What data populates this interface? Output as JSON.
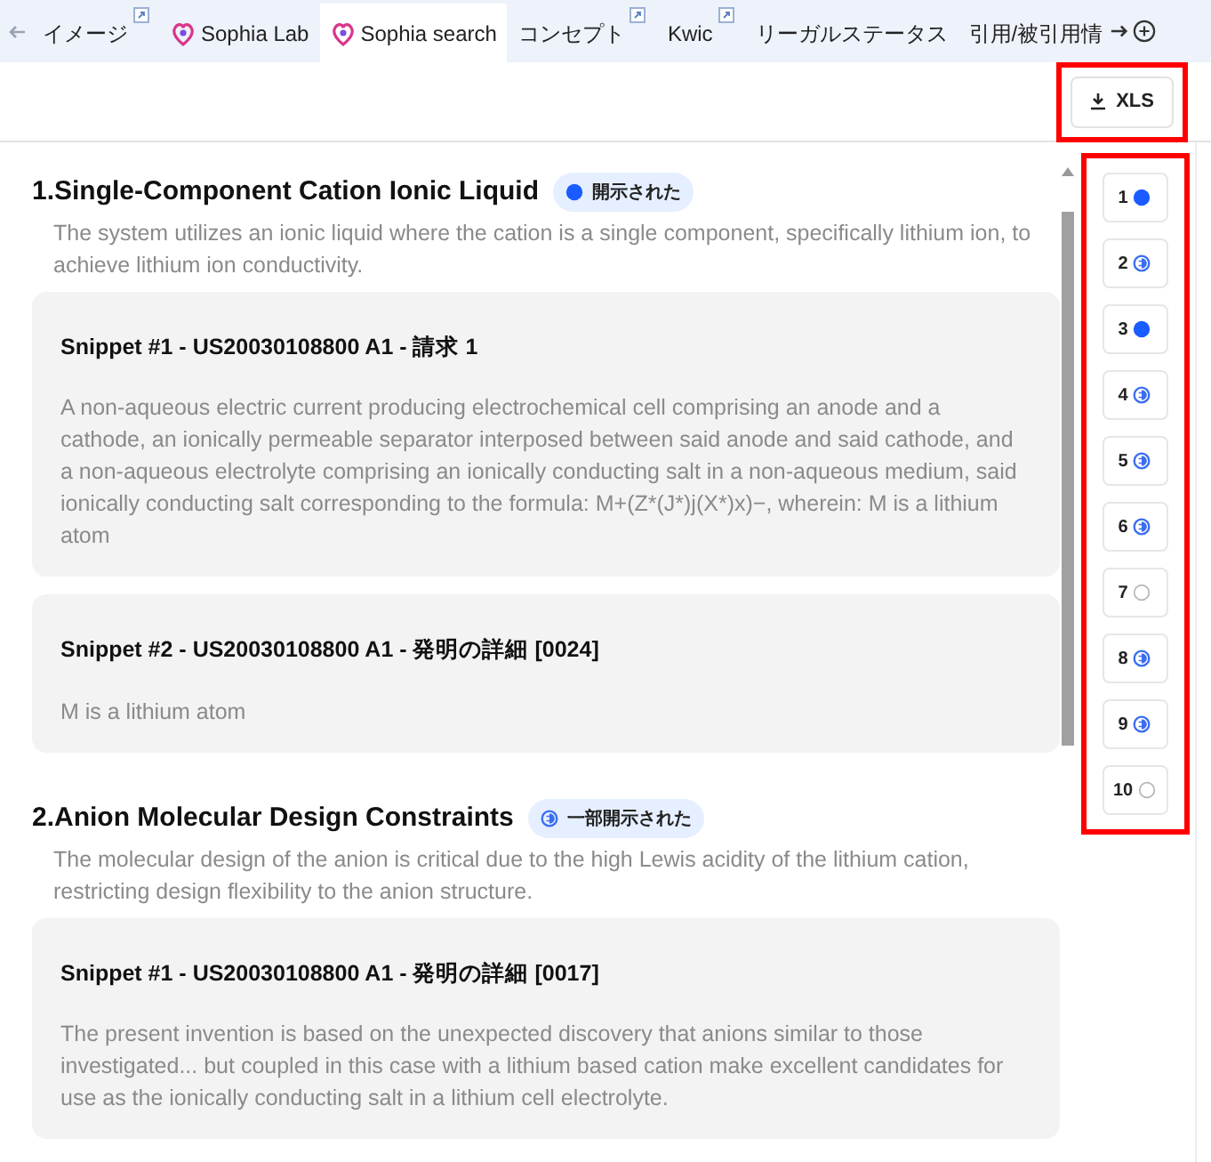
{
  "tabs": [
    {
      "label": "イメージ",
      "selected": false,
      "logo": false,
      "external": true
    },
    {
      "label": "Sophia Lab",
      "selected": false,
      "logo": true,
      "external": false
    },
    {
      "label": "Sophia search",
      "selected": true,
      "logo": true,
      "external": false
    },
    {
      "label": "コンセプト",
      "selected": false,
      "logo": false,
      "external": true
    },
    {
      "label": "Kwic",
      "selected": false,
      "logo": false,
      "external": true
    },
    {
      "label": "リーガルステータス",
      "selected": false,
      "logo": false,
      "external": false
    },
    {
      "label": "引用/被引用情",
      "selected": false,
      "logo": false,
      "external": false
    }
  ],
  "export_button": {
    "label": "XLS",
    "highlighted": true
  },
  "sections": [
    {
      "title": "1.Single-Component Cation Ionic Liquid",
      "status": {
        "kind": "full",
        "label": "開示された"
      },
      "description": "The system utilizes an ionic liquid where the cation is a single component, specifically lithium ion, to achieve lithium ion conductivity.",
      "snippets": [
        {
          "title": "Snippet #1 - US20030108800 A1 - 請求 1",
          "text": "A non-aqueous electric current producing electrochemical cell comprising an anode and a cathode, an ionically permeable separator interposed between said anode and said cathode, and a non-aqueous electrolyte comprising an ionically conducting salt in a non-aqueous medium, said ionically conducting salt corresponding to the formula: M+(Z*(J*)j(X*)x)−, wherein: M is a lithium atom"
        },
        {
          "title": "Snippet #2 - US20030108800 A1 - 発明の詳細 [0024]",
          "text": "M is a lithium atom"
        }
      ]
    },
    {
      "title": "2.Anion Molecular Design Constraints",
      "status": {
        "kind": "partial",
        "label": "一部開示された"
      },
      "description": "The molecular design of the anion is critical due to the high Lewis acidity of the lithium cation, restricting design flexibility to the anion structure.",
      "snippets": [
        {
          "title": "Snippet #1 - US20030108800 A1 - 発明の詳細 [0017]",
          "text": "The present invention is based on the unexpected discovery that anions similar to those investigated... but coupled in this case with a lithium based cation make excellent candidates for use as the ionically conducting salt in a lithium cell electrolyte."
        }
      ]
    }
  ],
  "navigator": {
    "highlighted": true,
    "items": [
      {
        "label": "1",
        "kind": "full"
      },
      {
        "label": "2",
        "kind": "partial"
      },
      {
        "label": "3",
        "kind": "full"
      },
      {
        "label": "4",
        "kind": "partial"
      },
      {
        "label": "5",
        "kind": "partial"
      },
      {
        "label": "6",
        "kind": "partial"
      },
      {
        "label": "7",
        "kind": "none"
      },
      {
        "label": "8",
        "kind": "partial"
      },
      {
        "label": "9",
        "kind": "partial"
      },
      {
        "label": "10",
        "kind": "none"
      }
    ]
  }
}
